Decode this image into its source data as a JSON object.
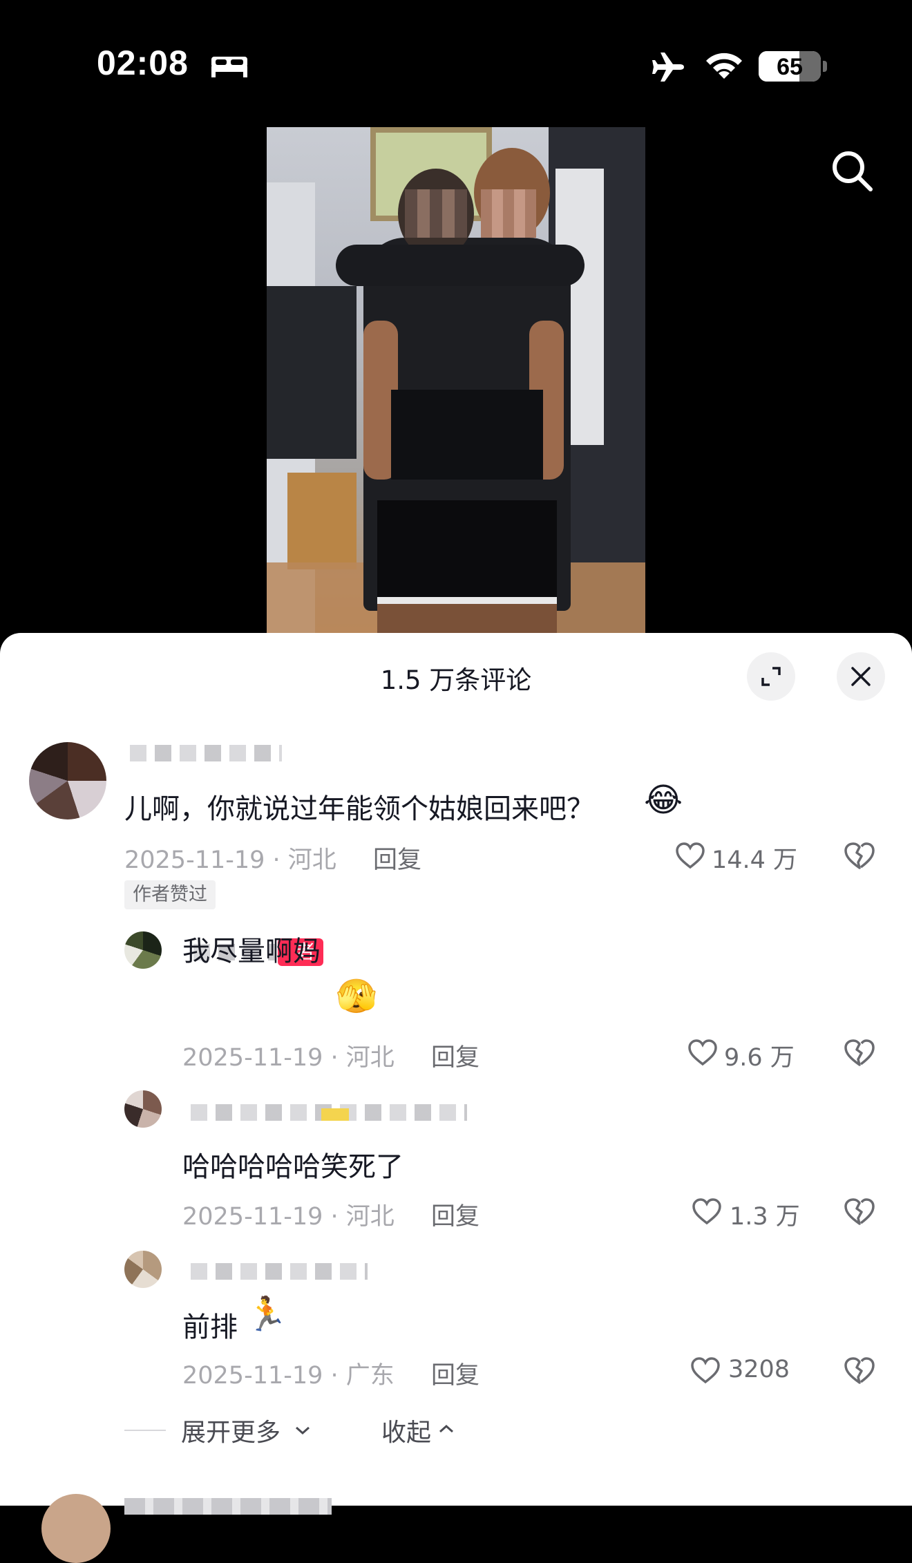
{
  "status_bar": {
    "time": "02:08",
    "battery_level": "65",
    "battery_fraction": 0.65,
    "icons": [
      "bed-icon",
      "airplane-icon",
      "wifi-icon",
      "battery-icon"
    ]
  },
  "video": {
    "search_icon": "search-icon"
  },
  "comments_panel": {
    "title": "1.5 万条评论",
    "expand_icon": "expand-icon",
    "close_icon": "close-icon"
  },
  "comments": {
    "main": {
      "text": "儿啊，你就说过年能领个姑娘回来吧？",
      "emoji": "😂",
      "meta": "2025-11-19 · 河北",
      "reply_label": "回复",
      "likes": "14.4 万",
      "badge": "作者赞过"
    },
    "replies": [
      {
        "author_tag": "者",
        "text": "我尽量啊妈",
        "emoji": "🫣",
        "meta": "2025-11-19 · 河北",
        "reply_label": "回复",
        "likes": "9.6 万"
      },
      {
        "text": "哈哈哈哈哈笑死了",
        "emoji": "",
        "meta": "2025-11-19 · 河北",
        "reply_label": "回复",
        "likes": "1.3 万"
      },
      {
        "text": "前排",
        "emoji": "🏃",
        "meta": "2025-11-19 · 广东",
        "reply_label": "回复",
        "likes": "3208"
      }
    ],
    "expand_more": "展开更多",
    "collapse": "收起"
  },
  "colors": {
    "accent": "#fe2c55",
    "text_primary": "#161823",
    "text_meta": "#a8a8ad"
  }
}
